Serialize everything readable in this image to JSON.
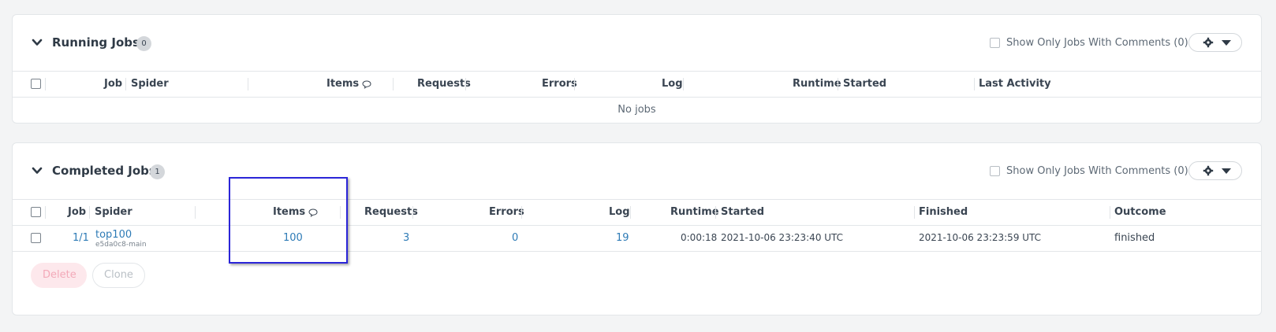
{
  "running": {
    "title": "Running Jobs",
    "count": "0",
    "comments_filter": "Show Only Jobs With Comments (0)",
    "columns": {
      "job": "Job",
      "spider": "Spider",
      "items": "Items",
      "requests": "Requests",
      "errors": "Errors",
      "log": "Log",
      "runtime": "Runtime",
      "started": "Started",
      "last_activity": "Last Activity"
    },
    "empty_text": "No jobs"
  },
  "completed": {
    "title": "Completed Jobs",
    "count": "1",
    "comments_filter": "Show Only Jobs With Comments (0)",
    "columns": {
      "job": "Job",
      "spider": "Spider",
      "items": "Items",
      "requests": "Requests",
      "errors": "Errors",
      "log": "Log",
      "runtime": "Runtime",
      "started": "Started",
      "finished": "Finished",
      "outcome": "Outcome"
    },
    "rows": [
      {
        "job": "1/1",
        "spider": "top100",
        "revision": "e5da0c8-main",
        "items": "100",
        "requests": "3",
        "errors": "0",
        "log": "19",
        "runtime": "0:00:18",
        "started": "2021-10-06 23:23:40 UTC",
        "finished": "2021-10-06 23:23:59 UTC",
        "outcome": "finished"
      }
    ],
    "delete_label": "Delete",
    "clone_label": "Clone"
  },
  "icons": {
    "collapse": "chevron-down-icon",
    "settings": "gear-icon",
    "dropdown": "caret-down-icon",
    "comment": "speech-bubble-icon"
  },
  "colors": {
    "link": "#2e7bb6",
    "highlight": "#2b25d8",
    "delete_disabled": "#fde8ec"
  }
}
